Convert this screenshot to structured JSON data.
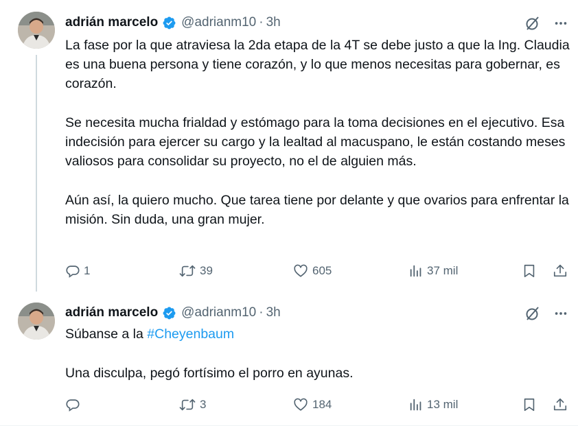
{
  "tweets": [
    {
      "author": {
        "name": "adrián marcelo",
        "handle": "@adrianm10",
        "verified": true
      },
      "separator": "·",
      "time": "3h",
      "paragraphs": [
        "La fase por la que atraviesa la 2da etapa de la 4T se debe justo a que la Ing. Claudia es una buena persona y tiene corazón, y lo que menos necesitas para gobernar, es corazón.",
        "Se necesita mucha frialdad y estómago para la toma decisiones en el ejecutivo. Esa indecisión  para ejercer su cargo y la lealtad al macuspano, le están costando meses valiosos para consolidar su proyecto, no el de alguien más.",
        "Aún así, la quiero mucho. Que tarea tiene por delante y que ovarios para enfrentar la misión. Sin duda, una gran mujer."
      ],
      "stats": {
        "replies": "1",
        "reposts": "39",
        "likes": "605",
        "views": "37 mil"
      }
    },
    {
      "author": {
        "name": "adrián marcelo",
        "handle": "@adrianm10",
        "verified": true
      },
      "separator": "·",
      "time": "3h",
      "intro": "Súbanse a la ",
      "hashtag": "#Cheyenbaum",
      "paragraph2": "Una disculpa, pegó fortísimo el porro en ayunas.",
      "stats": {
        "replies": "",
        "reposts": "3",
        "likes": "184",
        "views": "13 mil"
      }
    }
  ],
  "icons": {
    "verified": "verified-badge-icon",
    "grok": "grok-icon",
    "more": "more-icon",
    "reply": "reply-icon",
    "repost": "repost-icon",
    "like": "like-icon",
    "views": "views-icon",
    "bookmark": "bookmark-icon",
    "share": "share-icon"
  },
  "colors": {
    "text": "#0f1419",
    "secondary": "#536471",
    "accent": "#1d9bf0",
    "thread_line": "#cfd9de"
  }
}
